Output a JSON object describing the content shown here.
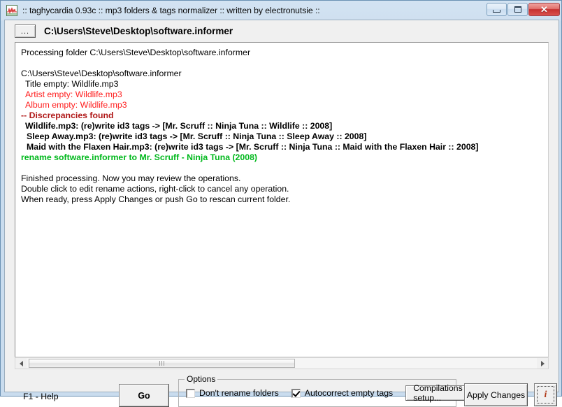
{
  "window": {
    "title": ":: taghycardia 0.93c :: mp3 folders & tags normalizer :: written by electronutsie ::",
    "icon": "waveform-icon",
    "minimize_label": "",
    "maximize_label": "",
    "close_label": "✕"
  },
  "pathbar": {
    "browse_label": "...",
    "path": "C:\\Users\\Steve\\Desktop\\software.informer"
  },
  "log": {
    "lines": [
      {
        "text": "Processing folder C:\\Users\\Steve\\Desktop\\software.informer",
        "style": "plain",
        "indent": 0
      },
      {
        "text": "",
        "style": "spacer",
        "indent": 0
      },
      {
        "text": "C:\\Users\\Steve\\Desktop\\software.informer",
        "style": "plain",
        "indent": 0
      },
      {
        "text": "Title empty: Wildlife.mp3",
        "style": "plain",
        "indent": 1
      },
      {
        "text": "Artist empty: Wildlife.mp3",
        "style": "red",
        "indent": 1
      },
      {
        "text": "Album empty: Wildlife.mp3",
        "style": "red",
        "indent": 1
      },
      {
        "text": "-- Discrepancies found",
        "style": "darkred",
        "indent": 0
      },
      {
        "text": "Wildlife.mp3: (re)write id3 tags -> [Mr. Scruff :: Ninja Tuna :: Wildlife :: 2008]",
        "style": "bold",
        "indent": 1
      },
      {
        "text": "Sleep Away.mp3: (re)write id3 tags -> [Mr. Scruff :: Ninja Tuna :: Sleep Away :: 2008]",
        "style": "bold",
        "indent": 2
      },
      {
        "text": "Maid with the Flaxen Hair.mp3: (re)write id3 tags -> [Mr. Scruff :: Ninja Tuna :: Maid with the Flaxen Hair :: 2008]",
        "style": "bold",
        "indent": 2
      },
      {
        "text": "rename software.informer to Mr. Scruff - Ninja Tuna (2008)",
        "style": "green",
        "indent": 0
      },
      {
        "text": "",
        "style": "spacer",
        "indent": 0
      },
      {
        "text": "Finished processing. Now you may review the operations.",
        "style": "plain",
        "indent": 0
      },
      {
        "text": "Double click to edit rename actions, right-click to cancel any operation.",
        "style": "plain",
        "indent": 0
      },
      {
        "text": "When ready, press Apply Changes or push Go to rescan current folder.",
        "style": "plain",
        "indent": 0
      }
    ]
  },
  "scrollbar": {
    "left_arrow": "scroll-left-arrow",
    "right_arrow": "scroll-right-arrow"
  },
  "bottom": {
    "help_text": "F1 - Help",
    "go_label": "Go",
    "options_legend": "Options",
    "dont_rename_label": "Don't rename folders",
    "dont_rename_checked": false,
    "autocorrect_label": "Autocorrect empty tags",
    "autocorrect_checked": true,
    "compilations_label": "Compilations setup...",
    "apply_label": "Apply Changes",
    "info_label": "i"
  },
  "colors": {
    "error_red": "#ff2020",
    "discrepancy_red": "#b01818",
    "success_green": "#00b81c",
    "close_button_red": "#c6302f",
    "aero_border": "#c3d9ec"
  }
}
